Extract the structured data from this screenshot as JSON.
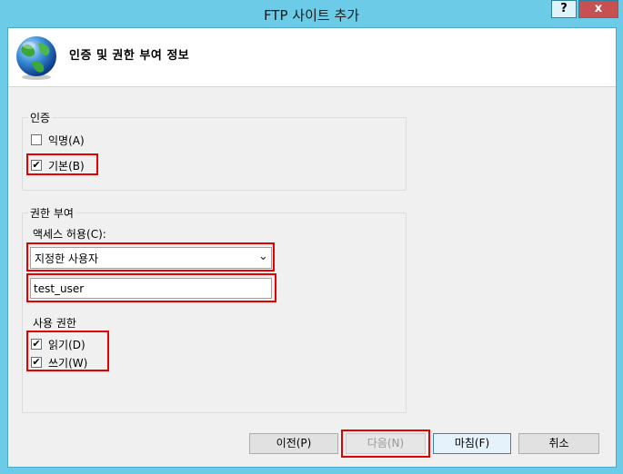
{
  "window": {
    "title": "FTP 사이트 추가",
    "help_label": "?",
    "close_label": "x"
  },
  "header": {
    "title": "인증 및 권한 부여 정보",
    "icon": "globe-icon"
  },
  "authentication": {
    "legend": "인증",
    "anonymous": {
      "label": "익명(A)",
      "checked": false
    },
    "basic": {
      "label": "기본(B)",
      "checked": true
    }
  },
  "authorization": {
    "legend": "권한 부여",
    "access_label": "액세스 허용(C):",
    "access_selected": "지정한 사용자",
    "user_value": "test_user",
    "permissions_label": "사용 권한",
    "read": {
      "label": "읽기(D)",
      "checked": true
    },
    "write": {
      "label": "쓰기(W)",
      "checked": true
    }
  },
  "buttons": {
    "previous": "이전(P)",
    "next": "다음(N)",
    "finish": "마침(F)",
    "cancel": "취소"
  },
  "check_mark": "✔",
  "colors": {
    "titlebar": "#6ccbe6",
    "highlight": "#e60000",
    "close": "#c75050"
  }
}
